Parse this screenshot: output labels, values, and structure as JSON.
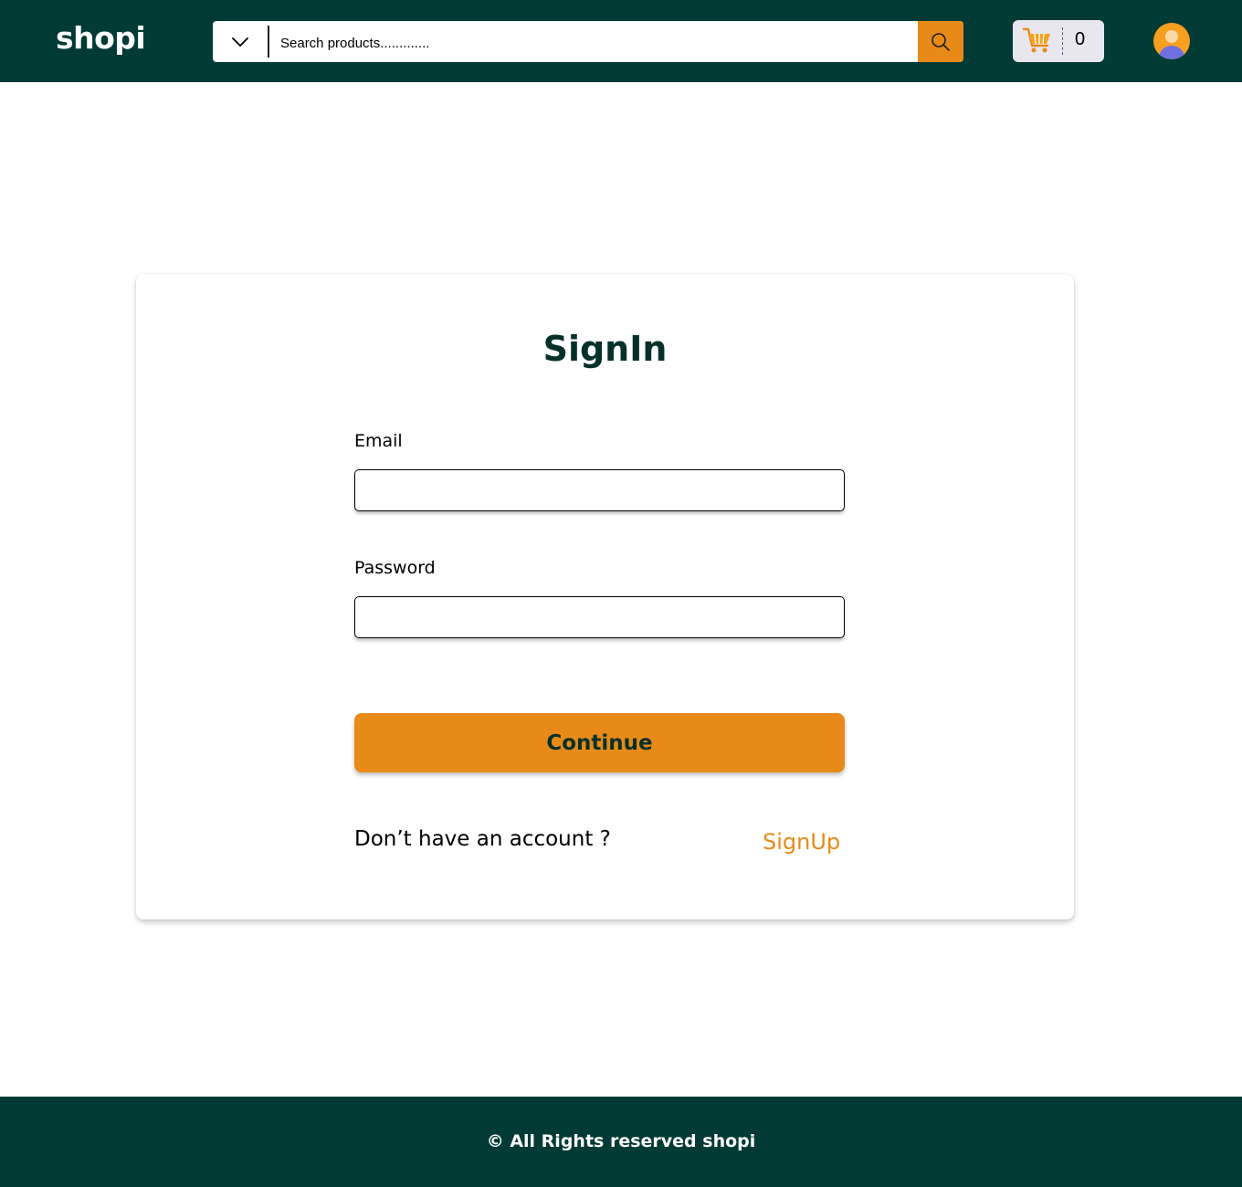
{
  "header": {
    "logo": "shopi",
    "search": {
      "placeholder": "Search products............."
    },
    "cart": {
      "count": "0"
    }
  },
  "signin": {
    "title": "SignIn",
    "email_label": "Email",
    "email_value": "",
    "password_label": "Password",
    "password_value": "",
    "continue_label": "Continue",
    "prompt": "Don’t have an account ?",
    "signup_label": "SignUp"
  },
  "footer": {
    "text": "© All Rights reserved shopi"
  },
  "icons": {
    "category": "chevron-down-icon",
    "search": "search-icon",
    "cart": "shopping-cart-icon",
    "avatar": "user-avatar-icon"
  },
  "colors": {
    "header_bg": "#023a35",
    "accent": "#e88a17",
    "title": "#07302b",
    "cart_bg": "#e8e6ef",
    "avatar_bg": "#f7a01f",
    "avatar_figure": "#6f6fe0"
  }
}
